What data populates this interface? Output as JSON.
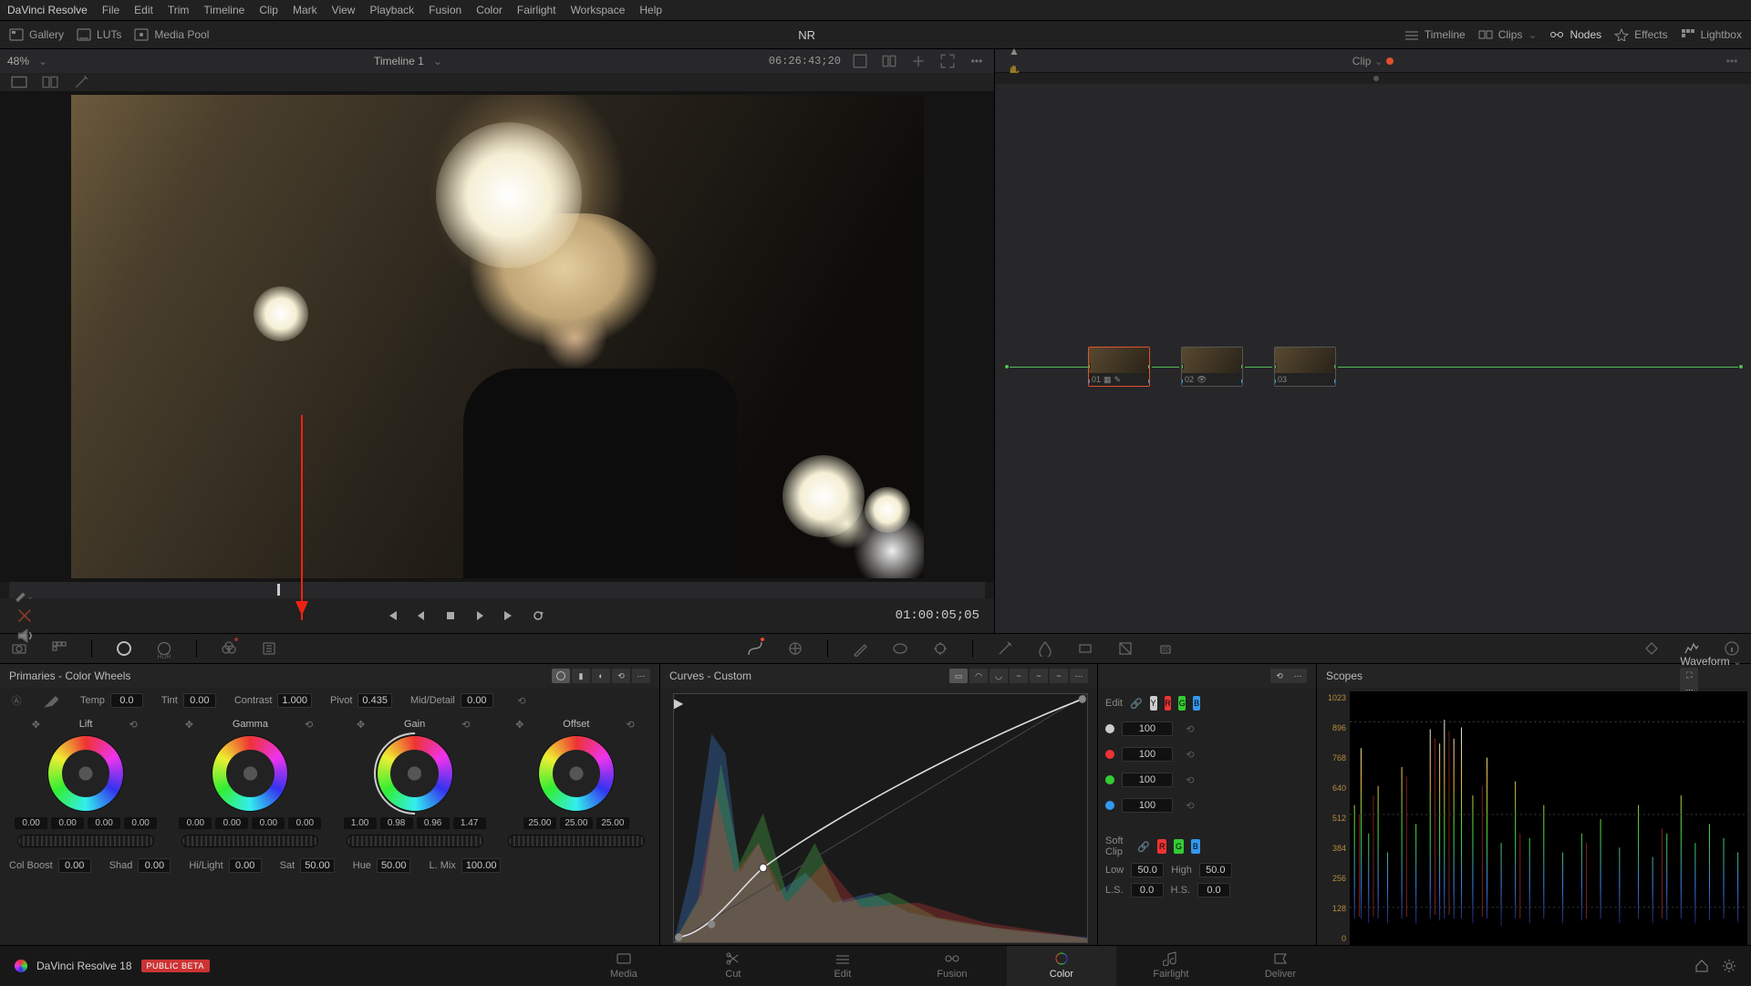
{
  "app": {
    "name": "DaVinci Resolve",
    "version": "DaVinci Resolve 18",
    "beta": "PUBLIC BETA",
    "project": "NR"
  },
  "menu": [
    "File",
    "Edit",
    "Trim",
    "Timeline",
    "Clip",
    "Mark",
    "View",
    "Playback",
    "Fusion",
    "Color",
    "Fairlight",
    "Workspace",
    "Help"
  ],
  "secbar": {
    "left": [
      {
        "n": "gallery-button",
        "l": "Gallery"
      },
      {
        "n": "luts-button",
        "l": "LUTs"
      },
      {
        "n": "mediapool-button",
        "l": "Media Pool"
      }
    ],
    "right": [
      {
        "n": "timeline-toggle",
        "l": "Timeline"
      },
      {
        "n": "clips-toggle",
        "l": "Clips"
      },
      {
        "n": "nodes-toggle",
        "l": "Nodes"
      },
      {
        "n": "effects-toggle",
        "l": "Effects"
      },
      {
        "n": "lightbox-toggle",
        "l": "Lightbox"
      }
    ]
  },
  "viewer": {
    "zoom": "48%",
    "timeline": "Timeline 1",
    "srcTC": "06:26:43;20",
    "recTC": "01:00:05;05"
  },
  "nodepanel": {
    "mode": "Clip",
    "nodes": [
      {
        "id": "01"
      },
      {
        "id": "02"
      },
      {
        "id": "03"
      }
    ]
  },
  "primaries": {
    "title": "Primaries - Color Wheels",
    "temp": {
      "l": "Temp",
      "v": "0.0"
    },
    "tint": {
      "l": "Tint",
      "v": "0.00"
    },
    "contrast": {
      "l": "Contrast",
      "v": "1.000"
    },
    "pivot": {
      "l": "Pivot",
      "v": "0.435"
    },
    "middetail": {
      "l": "Mid/Detail",
      "v": "0.00"
    },
    "row2": {
      "colboost": {
        "l": "Col Boost",
        "v": "0.00"
      },
      "shad": {
        "l": "Shad",
        "v": "0.00"
      },
      "hilight": {
        "l": "Hi/Light",
        "v": "0.00"
      },
      "sat": {
        "l": "Sat",
        "v": "50.00"
      },
      "hue": {
        "l": "Hue",
        "v": "50.00"
      },
      "lmix": {
        "l": "L. Mix",
        "v": "100.00"
      }
    },
    "wheels": [
      {
        "name": "Lift",
        "vals": [
          "0.00",
          "0.00",
          "0.00",
          "0.00"
        ]
      },
      {
        "name": "Gamma",
        "vals": [
          "0.00",
          "0.00",
          "0.00",
          "0.00"
        ]
      },
      {
        "name": "Gain",
        "vals": [
          "1.00",
          "0.98",
          "0.96",
          "1.47"
        ]
      },
      {
        "name": "Offset",
        "vals": [
          "25.00",
          "25.00",
          "25.00"
        ]
      }
    ]
  },
  "curves": {
    "title": "Curves - Custom",
    "edit": "Edit",
    "softclip": "Soft Clip",
    "channels": [
      {
        "c": "#ccc",
        "v": "100"
      },
      {
        "c": "#e33",
        "v": "100"
      },
      {
        "c": "#3c3",
        "v": "100"
      },
      {
        "c": "#39e",
        "v": "100"
      }
    ],
    "low": {
      "l": "Low",
      "v": "50.0"
    },
    "high": {
      "l": "High",
      "v": "50.0"
    },
    "ls": {
      "l": "L.S.",
      "v": "0.0"
    },
    "hs": {
      "l": "H.S.",
      "v": "0.0"
    }
  },
  "scopes": {
    "title": "Scopes",
    "mode": "Waveform",
    "labels": [
      "1023",
      "896",
      "768",
      "640",
      "512",
      "384",
      "256",
      "128",
      "0"
    ]
  },
  "pages": [
    {
      "n": "media",
      "l": "Media"
    },
    {
      "n": "cut",
      "l": "Cut"
    },
    {
      "n": "edit",
      "l": "Edit"
    },
    {
      "n": "fusion",
      "l": "Fusion"
    },
    {
      "n": "color",
      "l": "Color",
      "active": true
    },
    {
      "n": "fairlight",
      "l": "Fairlight"
    },
    {
      "n": "deliver",
      "l": "Deliver"
    }
  ]
}
